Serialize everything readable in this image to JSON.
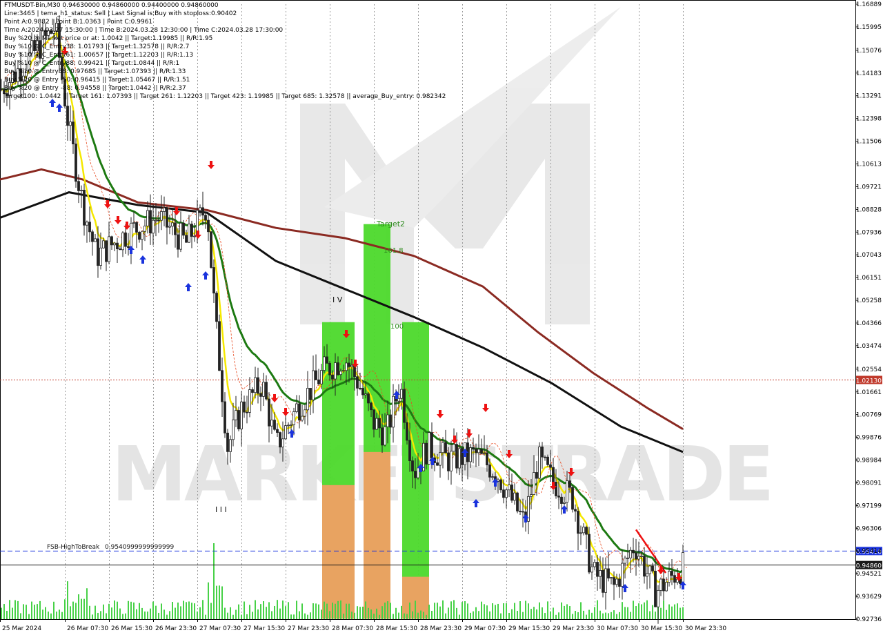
{
  "chart_data": {
    "type": "candlestick",
    "symbol": "FTMUSDT-Bin,M30",
    "title": "FTMUSDT-Bin,M30",
    "ohlc_header": "0.94630000 0.94860000 0.94400000 0.94860000",
    "info_lines": [
      "Line:3465 | tema_h1_status: Sell | Last Signal is:Buy with stoploss:0.90402",
      "Point A:0.9882 | Point B:1.0363 | Point C:0.9961",
      "Time A:2024.03.27 15:30:00 | Time B:2024.03.28 12:30:00 | Time C:2024.03.28 17:30:00",
      "Buy %20 @ Market price or at: 1.0042 || Target:1.19985 || R/R:1.95",
      "Buy %10 @ C_Entry38: 1.01793 || Target:1.32578 || R/R:2.7",
      "Buy %10 @ C_Entry61: 1.00657 || Target:1.12203 || R/R:1.13",
      "Buy %10 @ C_Entry88: 0.99421 || Target:1.0844 || R/R:1",
      "Buy %10 @ Entry38: 0.97685 || Target:1.07393 || R/R:1.33",
      "Buy %20 @ Entry -50: 0.96415 || Target:1.05467 || R/R:1.51",
      "Buy %20 @ Entry -88: 0.94558 || Target:1.0442 || R/R:2.37",
      "Target100: 1.0442 || Target 161: 1.07393 || Target 261: 1.12203 || Target 423: 1.19985 || Target 685: 1.32578 || average_Buy_entry: 0.982342"
    ],
    "y_ticks": [
      "1.16889",
      "1.15995",
      "1.15076",
      "1.14183",
      "1.13291",
      "1.12398",
      "1.11506",
      "1.10613",
      "1.09721",
      "1.08828",
      "1.07936",
      "1.07043",
      "1.06151",
      "1.05258",
      "1.04366",
      "1.03474",
      "1.02554",
      "1.01661",
      "1.00769",
      "0.99876",
      "0.98984",
      "0.98091",
      "0.97199",
      "0.96306",
      "0.95414",
      "0.94521",
      "0.93629",
      "0.92736"
    ],
    "ylim": [
      0.92736,
      1.16889
    ],
    "x_ticks": [
      "25 Mar 2024",
      "26 Mar 07:30",
      "26 Mar 15:30",
      "26 Mar 23:30",
      "27 Mar 07:30",
      "27 Mar 15:30",
      "27 Mar 23:30",
      "28 Mar 07:30",
      "28 Mar 15:30",
      "28 Mar 23:30",
      "29 Mar 07:30",
      "29 Mar 15:30",
      "29 Mar 23:30",
      "30 Mar 07:30",
      "30 Mar 15:30",
      "30 Mar 23:30"
    ],
    "price_levels": [
      {
        "label": "0.95410",
        "value": 0.9541,
        "color": "#1a33dd"
      },
      {
        "label": "0.94860",
        "value": 0.9486,
        "color": "#1a1a1a"
      },
      {
        "label": "1.02130",
        "value": 1.0213,
        "color": "#c0392b"
      }
    ],
    "annotations": {
      "fsb_label": "FSB-HighToBreak",
      "fsb_value": "0.9540999999999999",
      "target2": "Target2",
      "t161": "161.8",
      "t100": "100",
      "wave_iv": "I V",
      "wave_iii": "I I I"
    },
    "watermark": "MARKETSTRADE",
    "colors": {
      "bull_candle": "#222222",
      "bear_candle": "#222222",
      "tema_yellow": "#f5e800",
      "ma_green": "#1d7a12",
      "ma_darkred": "#8b2a22",
      "ma_black": "#111111",
      "volume": "#47d147",
      "zone_green": "#4cd92b",
      "zone_orange": "#f0a064",
      "buy_arrow": "#1a33dd",
      "sell_arrow": "#ee1111"
    }
  }
}
